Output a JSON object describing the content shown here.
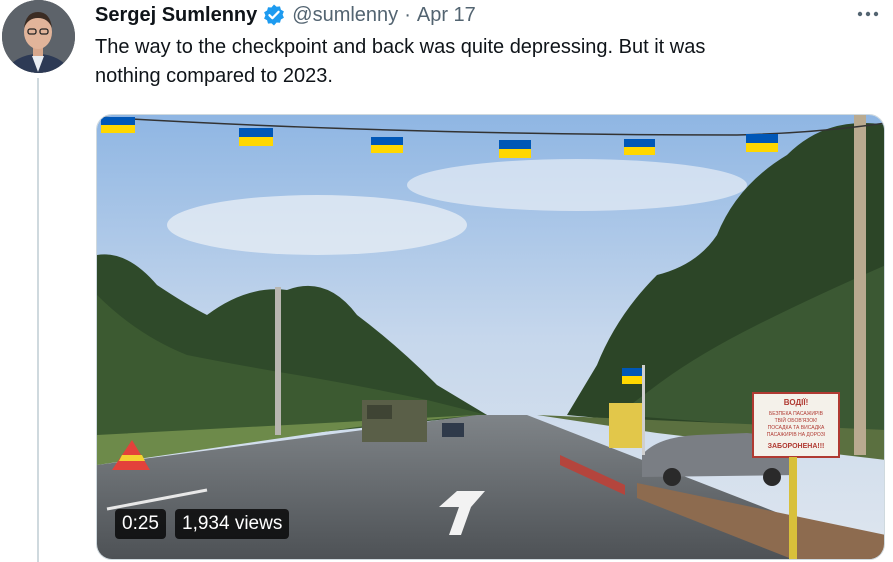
{
  "author": {
    "name": "Sergej Sumlenny",
    "handle": "@sumlenny",
    "separator": "·",
    "date": "Apr 17",
    "verified": true,
    "verified_color": "#1d9bf0"
  },
  "tweet": {
    "text": "The way to the checkpoint and back was quite depressing. But it was\nnothing compared to 2023."
  },
  "media": {
    "type": "video",
    "duration": "0:25",
    "views": "1,934 views",
    "sign_lines": [
      "ВОДІЇ!",
      "БЕЗПЕКА ПАСАЖИРІВ",
      "ТВІЙ ОБОВ'ЯЗОК!",
      "ПОСАДКА ТА ВИСАДКА",
      "ПАСАЖИРІВ НА ДОРОЗІ",
      "ЗАБОРОНЕНА!!!"
    ]
  },
  "icons": {
    "more": "more-horizontal-icon",
    "verified": "verified-badge-icon"
  },
  "colors": {
    "text": "#0f1419",
    "secondary": "#536471",
    "flag_blue": "#0057b7",
    "flag_yellow": "#ffd700"
  }
}
